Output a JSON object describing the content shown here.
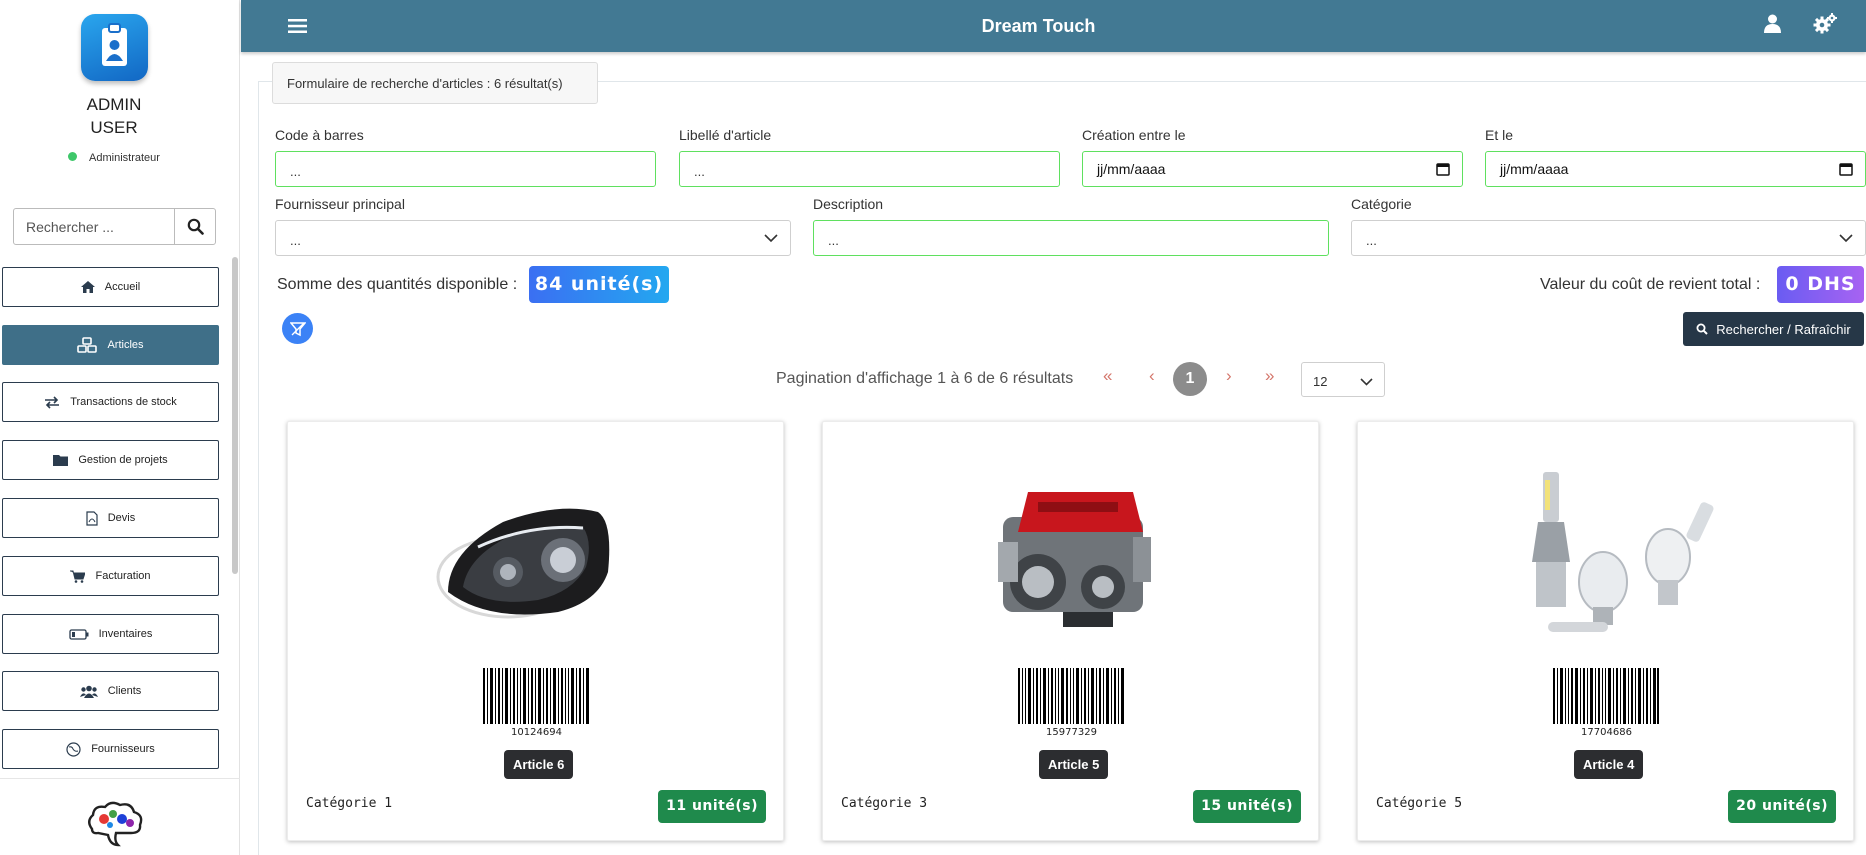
{
  "app": {
    "title": "Dream Touch"
  },
  "user": {
    "first": "ADMIN",
    "last": "USER",
    "role": "Administrateur",
    "status_color": "#3ec76a"
  },
  "sidebar": {
    "search_placeholder": "Rechercher ...",
    "items": [
      {
        "label": "Accueil",
        "icon": "home-icon"
      },
      {
        "label": "Articles",
        "icon": "boxes-icon",
        "active": true
      },
      {
        "label": "Transactions de stock",
        "icon": "exchange-icon"
      },
      {
        "label": "Gestion de projets",
        "icon": "folder-icon"
      },
      {
        "label": "Devis",
        "icon": "pdf-file-icon"
      },
      {
        "label": "Facturation",
        "icon": "cart-icon"
      },
      {
        "label": "Inventaires",
        "icon": "battery-icon"
      },
      {
        "label": "Clients",
        "icon": "users-icon"
      },
      {
        "label": "Fournisseurs",
        "icon": "globe-icon"
      }
    ]
  },
  "form": {
    "tab": "Formulaire de recherche d'articles : 6 résultat(s)",
    "barcode": {
      "label": "Code à barres",
      "value": "..."
    },
    "label": {
      "label": "Libellé d'article",
      "value": "..."
    },
    "created_from": {
      "label": "Création entre le",
      "value": "jj/mm/aaaa"
    },
    "created_to": {
      "label": "Et le",
      "value": "jj/mm/aaaa"
    },
    "supplier": {
      "label": "Fournisseur principal",
      "value": "..."
    },
    "description": {
      "label": "Description",
      "value": "..."
    },
    "category": {
      "label": "Catégorie",
      "value": "..."
    }
  },
  "summary": {
    "qty_label": "Somme des quantités disponible :",
    "qty_value": "84 unité(s)",
    "cost_label": "Valeur du coût de revient total :",
    "cost_value": "0 DHS"
  },
  "search_button": "Rechercher / Rafraîchir",
  "pagination": {
    "text": "Pagination d'affichage 1 à 6 de 6 résultats",
    "first": "«",
    "prev": "‹",
    "current": "1",
    "next": "›",
    "last": "»",
    "page_size": "12"
  },
  "cards": [
    {
      "barcode": "10124694",
      "name": "Article 6",
      "category": "Catégorie 1",
      "stock": "11 unité(s)",
      "image": "headlight"
    },
    {
      "barcode": "15977329",
      "name": "Article 5",
      "category": "Catégorie 3",
      "stock": "15 unité(s)",
      "image": "engine"
    },
    {
      "barcode": "17704686",
      "name": "Article 4",
      "category": "Catégorie 5",
      "stock": "20 unité(s)",
      "image": "bulbs"
    }
  ]
}
